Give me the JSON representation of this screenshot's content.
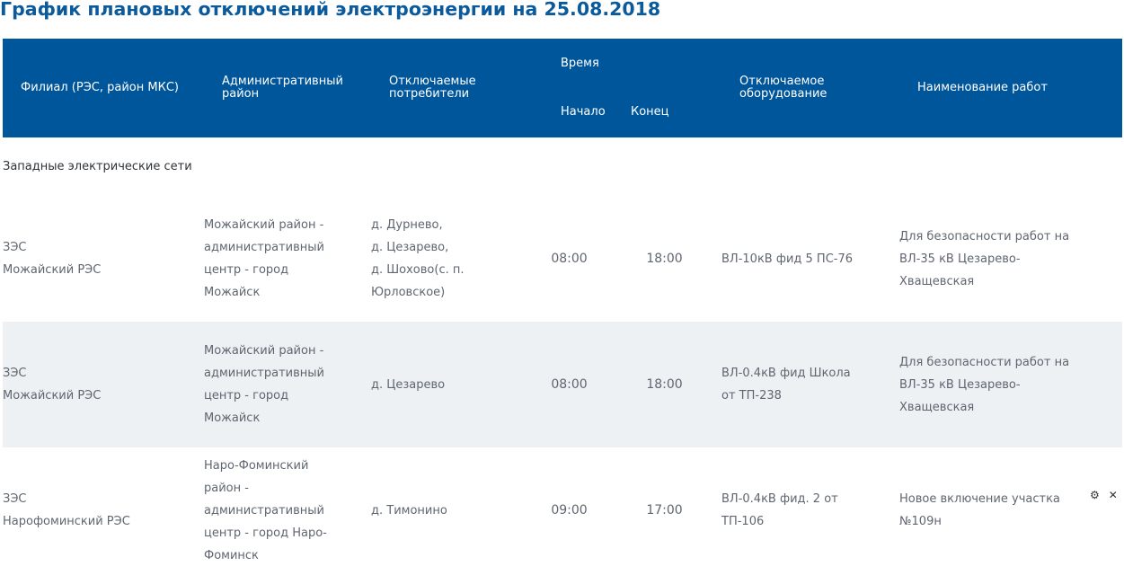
{
  "title": "График плановых отключений электроэнергии на 25.08.2018",
  "headers": {
    "branch": "Филиал (РЭС, район МКС)",
    "district_line1": "Административный",
    "district_line2": "район",
    "consumers_line1": "Отключаемые",
    "consumers_line2": "потребители",
    "time": "Время",
    "start": "Начало",
    "end": "Конец",
    "equipment_line1": "Отключаемое",
    "equipment_line2": "оборудование",
    "works": "Наименование работ"
  },
  "section": "Западные электрические сети",
  "rows": [
    {
      "branch": [
        "ЗЭС",
        "Можайский РЭС"
      ],
      "district": [
        "Можайский район -",
        "административный",
        "центр - город",
        "Можайск"
      ],
      "consumers": [
        "д. Дурнево,",
        "д. Цезарево,",
        "д. Шохово(с. п.",
        "Юрловское)"
      ],
      "start": "08:00",
      "end": "18:00",
      "equipment": [
        "ВЛ-10кВ фид 5 ПС-76"
      ],
      "works": [
        "Для безопасности работ на",
        "ВЛ-35 кВ Цезарево-",
        "Хващевская"
      ]
    },
    {
      "branch": [
        "ЗЭС",
        "Можайский РЭС"
      ],
      "district": [
        "Можайский район -",
        "административный",
        "центр - город",
        "Можайск"
      ],
      "consumers": [
        "д. Цезарево"
      ],
      "start": "08:00",
      "end": "18:00",
      "equipment": [
        "ВЛ-0.4кВ фид Школа",
        "от ТП-238"
      ],
      "works": [
        "Для безопасности работ на",
        "ВЛ-35 кВ Цезарево-",
        "Хващевская"
      ]
    },
    {
      "branch": [
        "ЗЭС",
        "Нарофоминский РЭС"
      ],
      "district": [
        "Наро-Фоминский",
        "район -",
        "административный",
        "центр - город Наро-",
        "Фоминск"
      ],
      "consumers": [
        "д. Тимонино"
      ],
      "start": "09:00",
      "end": "17:00",
      "equipment": [
        "ВЛ-0.4кВ фид. 2 от",
        "ТП-106"
      ],
      "works": [
        "Новое включение участка",
        "№109н"
      ]
    }
  ],
  "controls": {
    "settings_glyph": "⚙",
    "close_glyph": "✕"
  },
  "colors": {
    "title": "#0b5a9c",
    "header_bg": "#00569b",
    "row_alt_bg": "#edf1f4"
  }
}
